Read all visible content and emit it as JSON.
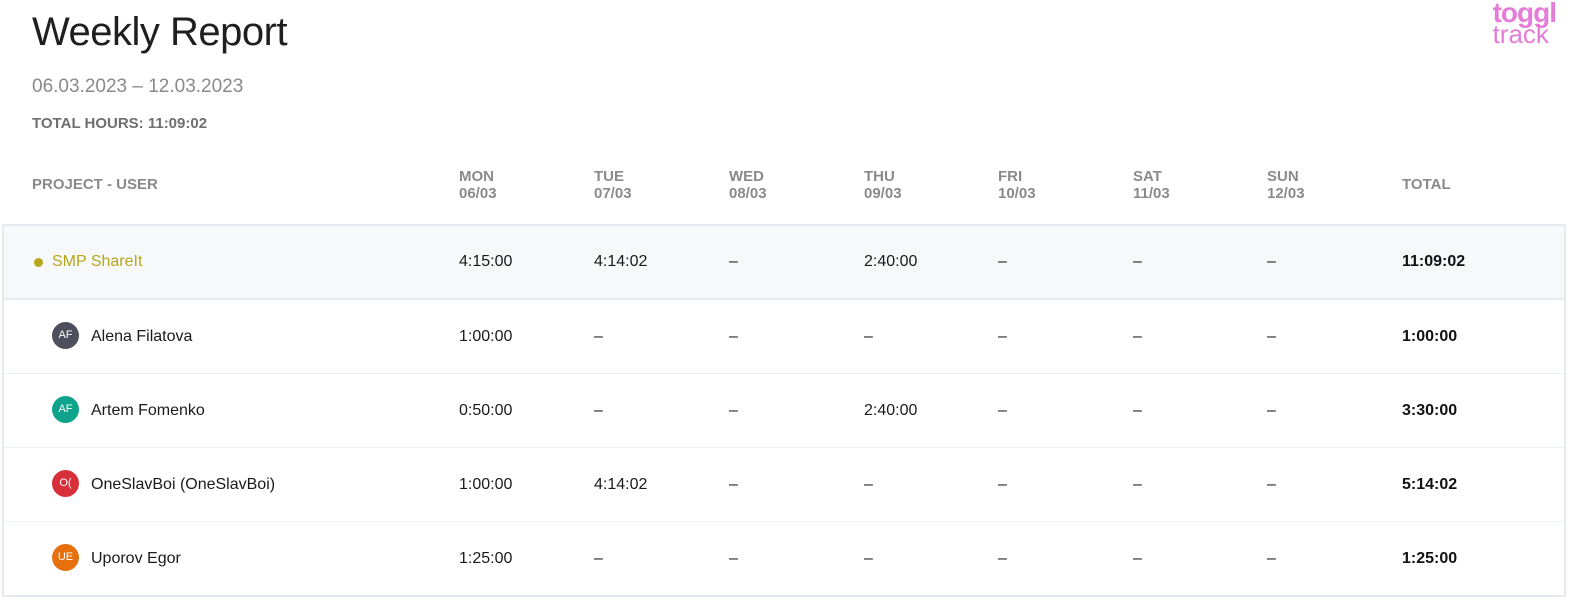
{
  "report": {
    "title": "Weekly Report",
    "date_range": "06.03.2023 – 12.03.2023",
    "total_hours": "TOTAL HOURS: 11:09:02"
  },
  "logo": {
    "line1": "toggl",
    "line2": "track",
    "color": "#e57cd8"
  },
  "table": {
    "header": {
      "project_user": "PROJECT - USER",
      "total": "TOTAL",
      "days": [
        {
          "day": "MON",
          "date": "06/03"
        },
        {
          "day": "TUE",
          "date": "07/03"
        },
        {
          "day": "WED",
          "date": "08/03"
        },
        {
          "day": "THU",
          "date": "09/03"
        },
        {
          "day": "FRI",
          "date": "10/03"
        },
        {
          "day": "SAT",
          "date": "11/03"
        },
        {
          "day": "SUN",
          "date": "12/03"
        }
      ]
    },
    "project": {
      "name": "SMP ShareIt",
      "color": "#b5a61b",
      "values": [
        "4:15:00",
        "4:14:02",
        "–",
        "2:40:00",
        "–",
        "–",
        "–"
      ],
      "total": "11:09:02"
    },
    "users": [
      {
        "initials": "AF",
        "name": "Alena Filatova",
        "avatar_color": "#4e4e5c",
        "values": [
          "1:00:00",
          "–",
          "–",
          "–",
          "–",
          "–",
          "–"
        ],
        "total": "1:00:00"
      },
      {
        "initials": "AF",
        "name": "Artem Fomenko",
        "avatar_color": "#10a38b",
        "values": [
          "0:50:00",
          "–",
          "–",
          "2:40:00",
          "–",
          "–",
          "–"
        ],
        "total": "3:30:00"
      },
      {
        "initials": "O(",
        "name": "OneSlavBoi (OneSlavBoi)",
        "avatar_color": "#d8303a",
        "values": [
          "1:00:00",
          "4:14:02",
          "–",
          "–",
          "–",
          "–",
          "–"
        ],
        "total": "5:14:02"
      },
      {
        "initials": "UE",
        "name": "Uporov Egor",
        "avatar_color": "#e5700d",
        "values": [
          "1:25:00",
          "–",
          "–",
          "–",
          "–",
          "–",
          "–"
        ],
        "total": "1:25:00"
      }
    ]
  }
}
